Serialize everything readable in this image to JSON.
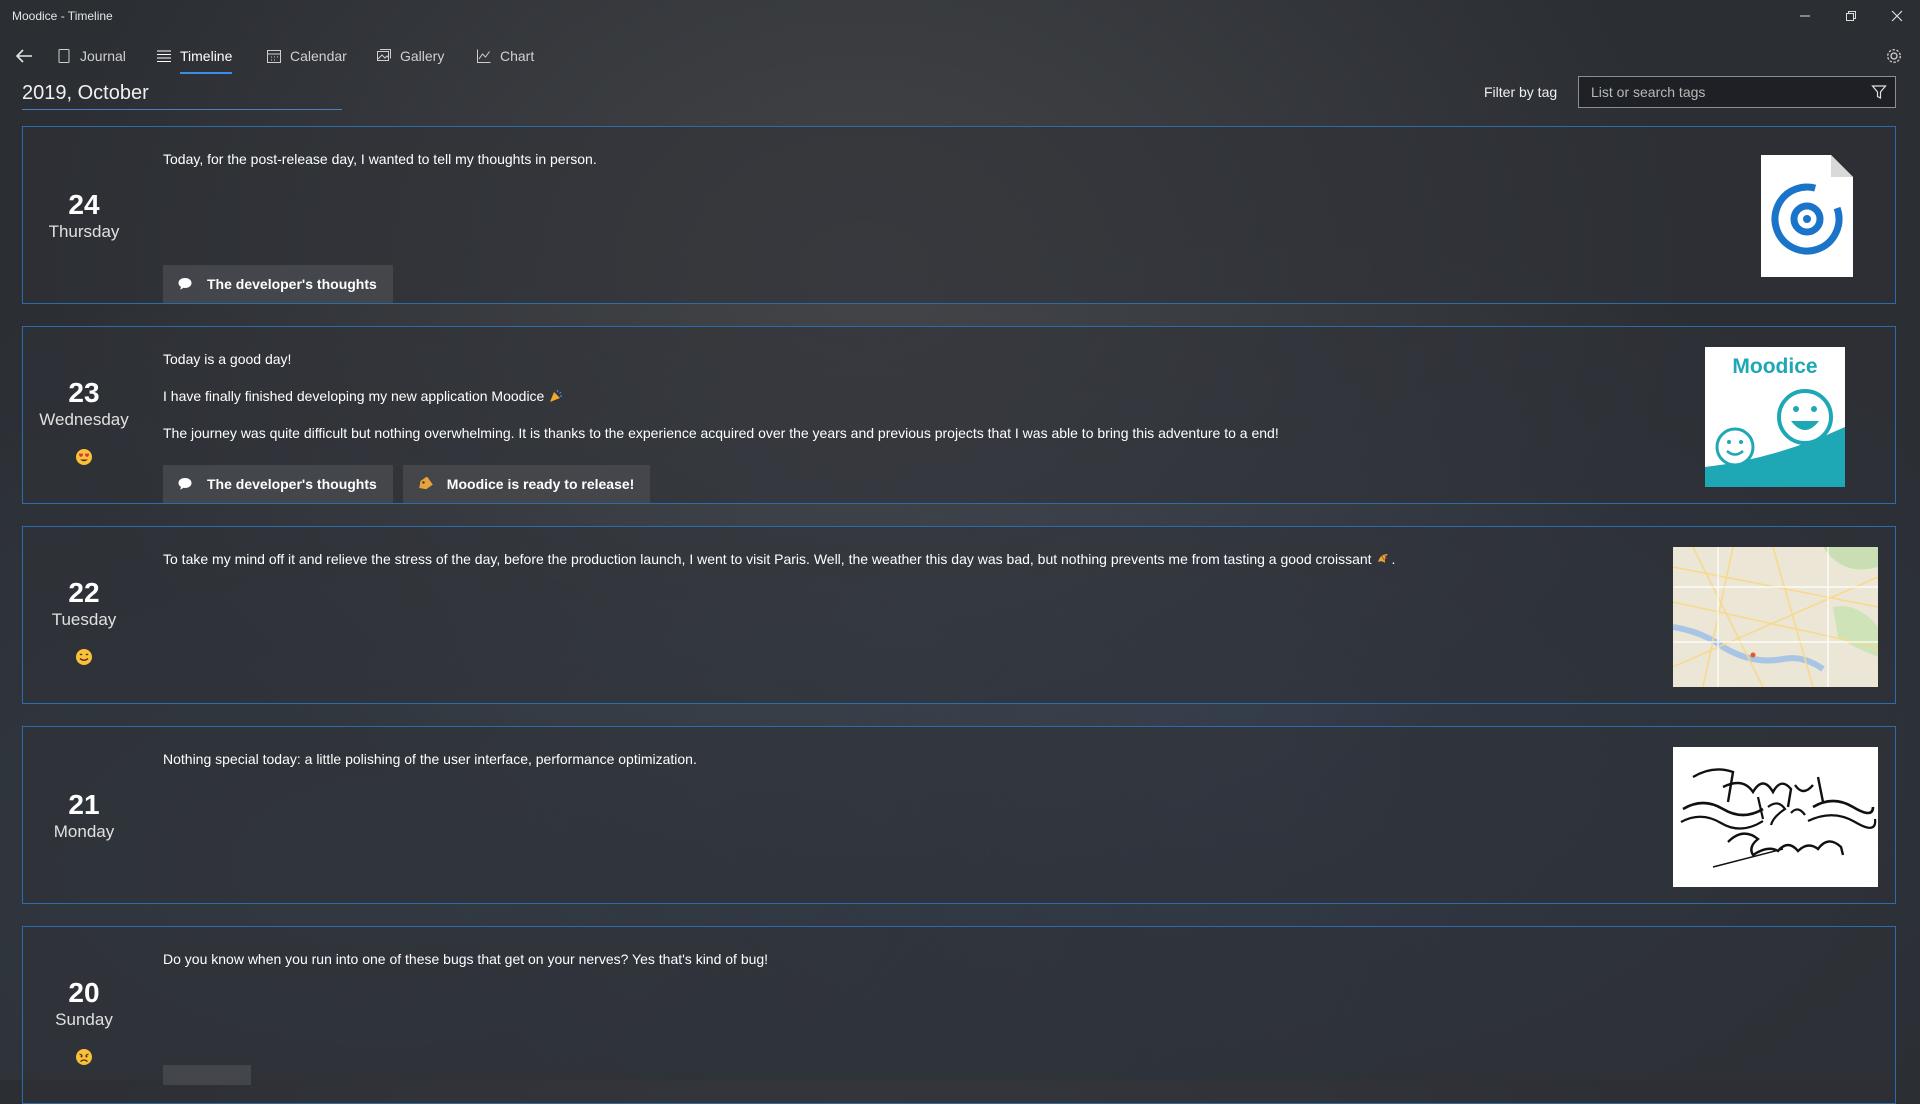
{
  "window": {
    "title": "Moodice - Timeline"
  },
  "nav": {
    "tabs": [
      {
        "label": "Journal",
        "icon": "journal-icon"
      },
      {
        "label": "Timeline",
        "icon": "timeline-icon",
        "active": true
      },
      {
        "label": "Calendar",
        "icon": "calendar-icon"
      },
      {
        "label": "Gallery",
        "icon": "gallery-icon"
      },
      {
        "label": "Chart",
        "icon": "chart-icon"
      }
    ]
  },
  "header": {
    "month": "2019, October"
  },
  "filter": {
    "label": "Filter by tag",
    "placeholder": "List or search tags"
  },
  "colors": {
    "accent": "#3a8ee6",
    "card_border": "#2c6cae",
    "logo_teal": "#1ea8b5"
  },
  "entries": [
    {
      "day": "24",
      "weekday": "Thursday",
      "paragraphs": [
        "Today, for the post-release day, I wanted to tell my thoughts in person."
      ],
      "tags": [
        {
          "label": "The developer's thoughts",
          "icon": "speech-bubble-icon"
        }
      ],
      "thumbnail": "audio-file-icon"
    },
    {
      "day": "23",
      "weekday": "Wednesday",
      "mood": "heart-eyes-emoji",
      "paragraphs": [
        "Today is a good day!",
        "I have finally finished developing my new application Moodice",
        "The journey was quite difficult but nothing overwhelming. It is thanks to the experience acquired over the years and previous projects that I was able to bring this adventure to a end!"
      ],
      "tags": [
        {
          "label": "The developer's thoughts",
          "icon": "speech-bubble-icon"
        },
        {
          "label": "Moodice is ready to release!",
          "icon": "label-tag-icon"
        }
      ],
      "thumbnail_text": "Moodice"
    },
    {
      "day": "22",
      "weekday": "Tuesday",
      "mood": "smiling-emoji",
      "paragraphs": [
        "To take my mind off it and relieve the stress of the day, before the production launch, I went to visit Paris. Well, the weather this day was bad, but nothing prevents me from tasting a good croissant"
      ],
      "thumbnail": "map-image"
    },
    {
      "day": "21",
      "weekday": "Monday",
      "paragraphs": [
        "Nothing special today: a little polishing of the user interface, performance optimization."
      ],
      "thumbnail": "sketch-image"
    },
    {
      "day": "20",
      "weekday": "Sunday",
      "mood": "frustrated-emoji",
      "paragraphs": [
        "Do you know when you run into one of these bugs that get on your nerves? Yes that's kind of bug!"
      ]
    }
  ]
}
